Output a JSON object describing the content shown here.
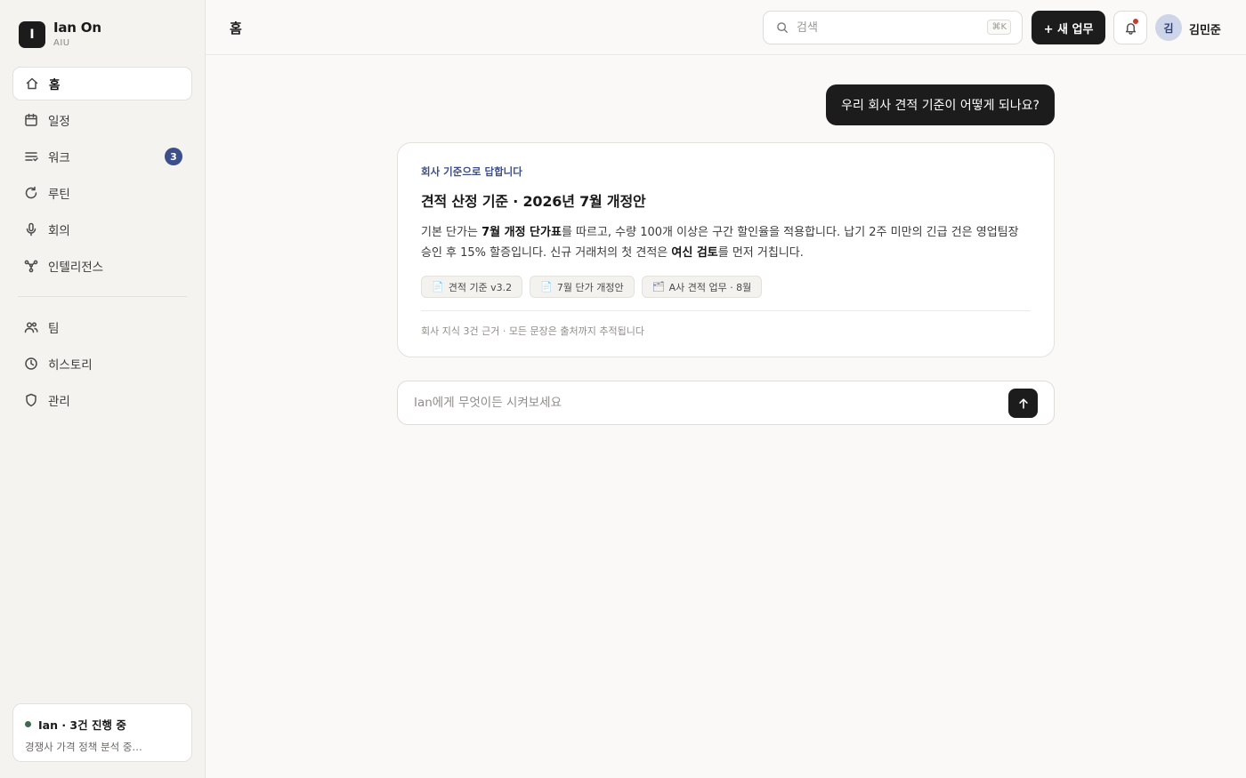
{
  "brand": {
    "logo_letter": "I",
    "name": "Ian On",
    "sub": "AIU"
  },
  "sidebar": {
    "items": [
      {
        "label": "홈",
        "icon": "home-icon",
        "active": true
      },
      {
        "label": "일정",
        "icon": "calendar-icon"
      },
      {
        "label": "워크",
        "icon": "list-icon",
        "badge": "3"
      },
      {
        "label": "루틴",
        "icon": "refresh-icon"
      },
      {
        "label": "회의",
        "icon": "microphone-icon"
      },
      {
        "label": "인텔리전스",
        "icon": "network-icon"
      }
    ],
    "items2": [
      {
        "label": "팀",
        "icon": "users-icon"
      },
      {
        "label": "히스토리",
        "icon": "clock-icon"
      },
      {
        "label": "관리",
        "icon": "shield-icon"
      }
    ],
    "status": {
      "title": "Ian · 3건 진행 중",
      "desc": "경쟁사 가격 정책 분석 중…",
      "dot_color": "#3e6b4f"
    }
  },
  "header": {
    "title": "홈",
    "search_placeholder": "검색",
    "search_shortcut": "⌘K",
    "new_task_label": "+ 새 업무",
    "avatar_initial": "김",
    "user_name": "김민준"
  },
  "chat": {
    "user_message": "우리 회사 견적 기준이 어떻게 되나요?",
    "answer": {
      "label": "회사 기준으로 답합니다",
      "title": "견적 산정 기준 · 2026년 7월 개정안",
      "body_p1": "기본 단가는 ",
      "body_b1": "7월 개정 단가표",
      "body_p2": "를 따르고, 수량 100개 이상은 구간 할인율을 적용합니다. 납기 2주 미만의 긴급 건은 영업팀장 승인 후 15% 할증입니다. 신규 거래처의 첫 견적은 ",
      "body_b2": "여신 검토",
      "body_p3": "를 먼저 거칩니다.",
      "sources": [
        {
          "icon": "📄",
          "label": "견적 기준 v3.2"
        },
        {
          "icon": "📄",
          "label": "7월 단가 개정안"
        },
        {
          "icon": "🗂",
          "label": "A사 견적 업무 · 8월"
        }
      ],
      "footer": "회사 지식 3건 근거 · 모든 문장은 출처까지 추적됩니다"
    },
    "composer_placeholder": "Ian에게 무엇이든 시켜보세요"
  },
  "colors": {
    "accent": "#3d4f8a",
    "primary_button": "#1c1c1c",
    "notification_dot": "#c43b32"
  }
}
